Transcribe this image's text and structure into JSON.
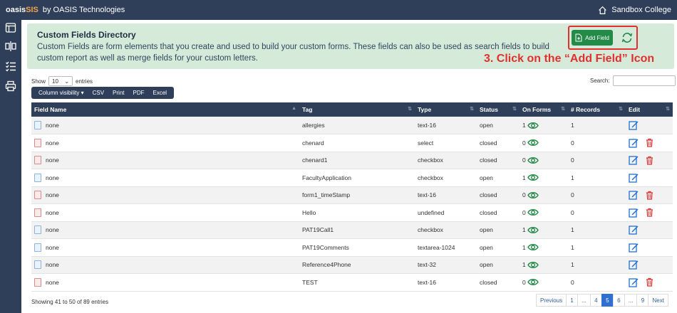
{
  "topbar": {
    "brand_main": "oasis",
    "brand_sis": "SIS",
    "byline": "by OASIS Technologies",
    "institution": "Sandbox College"
  },
  "banner": {
    "title": "Custom Fields Directory",
    "description": "Custom Fields are form elements that you create and used to build your custom forms. These fields can also be used as search fields to build custom report as well as merge fields for your custom letters.",
    "add_field_label": "Add Field"
  },
  "instruction": "3. Click on the “Add Field” Icon",
  "controls": {
    "show_label": "Show",
    "entries_value": "10",
    "entries_label": "entries",
    "search_label": "Search:",
    "buttons": [
      "Column visibility ▾",
      "CSV",
      "Print",
      "PDF",
      "Excel"
    ]
  },
  "table": {
    "headers": [
      "Field Name",
      "Tag",
      "Type",
      "Status",
      "On Forms",
      "# Records",
      "Edit"
    ],
    "rows": [
      {
        "name": "none",
        "tag": "allergies",
        "type": "text-16",
        "status": "open",
        "on_forms": "1",
        "records": "1",
        "deletable": false
      },
      {
        "name": "none",
        "tag": "chenard",
        "type": "select",
        "status": "closed",
        "on_forms": "0",
        "records": "0",
        "deletable": true
      },
      {
        "name": "none",
        "tag": "chenard1",
        "type": "checkbox",
        "status": "closed",
        "on_forms": "0",
        "records": "0",
        "deletable": true
      },
      {
        "name": "none",
        "tag": "FacultyApplication",
        "type": "checkbox",
        "status": "open",
        "on_forms": "1",
        "records": "1",
        "deletable": false
      },
      {
        "name": "none",
        "tag": "form1_timeStamp",
        "type": "text-16",
        "status": "closed",
        "on_forms": "0",
        "records": "0",
        "deletable": true
      },
      {
        "name": "none",
        "tag": "Hello",
        "type": "undefined",
        "status": "closed",
        "on_forms": "0",
        "records": "0",
        "deletable": true
      },
      {
        "name": "none",
        "tag": "PAT19Call1",
        "type": "checkbox",
        "status": "open",
        "on_forms": "1",
        "records": "1",
        "deletable": false
      },
      {
        "name": "none",
        "tag": "PAT19Comments",
        "type": "textarea-1024",
        "status": "open",
        "on_forms": "1",
        "records": "1",
        "deletable": false
      },
      {
        "name": "none",
        "tag": "Reference4Phone",
        "type": "text-32",
        "status": "open",
        "on_forms": "1",
        "records": "1",
        "deletable": false
      },
      {
        "name": "none",
        "tag": "TEST",
        "type": "text-16",
        "status": "closed",
        "on_forms": "0",
        "records": "0",
        "deletable": true
      }
    ]
  },
  "footer": {
    "info": "Showing 41 to 50 of 89 entries",
    "pages": [
      "Previous",
      "1",
      "...",
      "4",
      "5",
      "6",
      "...",
      "9",
      "Next"
    ],
    "active_page": "5"
  },
  "colors": {
    "navy": "#2f3f5a",
    "green": "#238a48",
    "red": "#e0302f",
    "banner_bg": "#d6ead9"
  }
}
